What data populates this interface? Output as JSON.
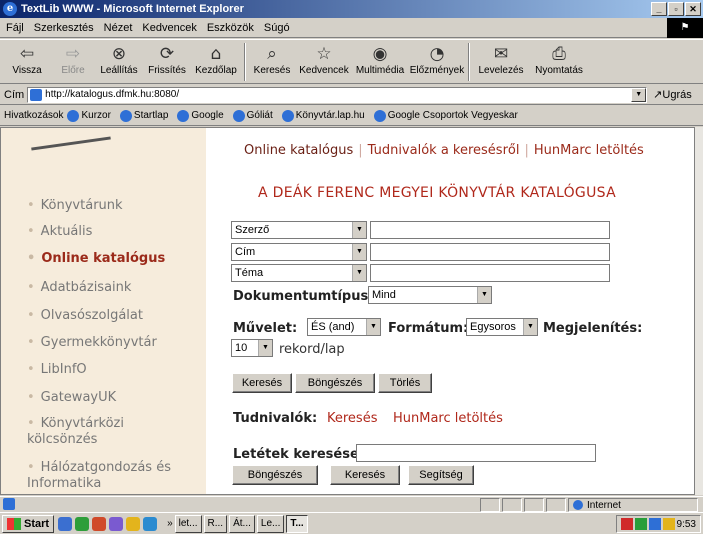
{
  "window": {
    "title": "TextLib WWW - Microsoft Internet Explorer",
    "btn_min": "_",
    "btn_max": "▫",
    "btn_close": "✕"
  },
  "menu": [
    "Fájl",
    "Szerkesztés",
    "Nézet",
    "Kedvencek",
    "Eszközök",
    "Súgó"
  ],
  "toolbar": {
    "back": "Vissza",
    "forward": "Előre",
    "stop": "Leállítás",
    "refresh": "Frissítés",
    "home": "Kezdőlap",
    "search": "Keresés",
    "favorites": "Kedvencek",
    "media": "Multimédia",
    "history": "Előzmények",
    "mail": "Levelezés",
    "print": "Nyomtatás"
  },
  "address": {
    "label": "Cím",
    "url": "http://katalogus.dfmk.hu:8080/",
    "go": "Ugrás"
  },
  "links": {
    "label": "Hivatkozások",
    "items": [
      "Kurzor",
      "Startlap",
      "Google",
      "Góliát",
      "Könyvtár.lap.hu",
      "Google Csoportok Vegyeskar"
    ]
  },
  "sidebar": {
    "items": [
      "Könyvtárunk",
      "Aktuális",
      "Online katalógus",
      "Adatbázisaink",
      "Olvasószolgálat",
      "Gyermekkönyvtár",
      "LibInfO",
      "GatewayUK",
      "Könyvtárközi kölcsönzés",
      "Hálózatgondozás és Informatika"
    ]
  },
  "top_links": [
    "Online katalógus",
    "Tudnivalók a keresésről",
    "HunMarc letöltés"
  ],
  "heading": "A DEÁK FERENC MEGYEI KÖNYVTÁR KATALÓGUSA",
  "search": {
    "field1": "Szerző",
    "field2": "Cím",
    "field3": "Téma",
    "doctype_label": "Dokumentumtípus:",
    "doctype_value": "Mind",
    "operation_label": "Művelet:",
    "operation_value": "ÉS (and)",
    "format_label": "Formátum:",
    "format_value": "Egysoros",
    "display_label": "Megjelenítés:",
    "display_value": "10",
    "display_unit": "rekord/lap",
    "btn_search": "Keresés",
    "btn_browse": "Böngészés",
    "btn_clear": "Törlés"
  },
  "info": {
    "label": "Tudnivalók:",
    "link1": "Keresés",
    "link2": "HunMarc letöltés"
  },
  "holdings": {
    "label": "Letétek keresése:",
    "btn_browse": "Böngészés",
    "btn_search": "Keresés",
    "btn_help": "Segítség"
  },
  "status": {
    "zone": "Internet"
  },
  "taskbar": {
    "start": "Start",
    "items": [
      "let...",
      "R...",
      "Át...",
      "Le...",
      "T..."
    ],
    "clock": "9:53"
  }
}
